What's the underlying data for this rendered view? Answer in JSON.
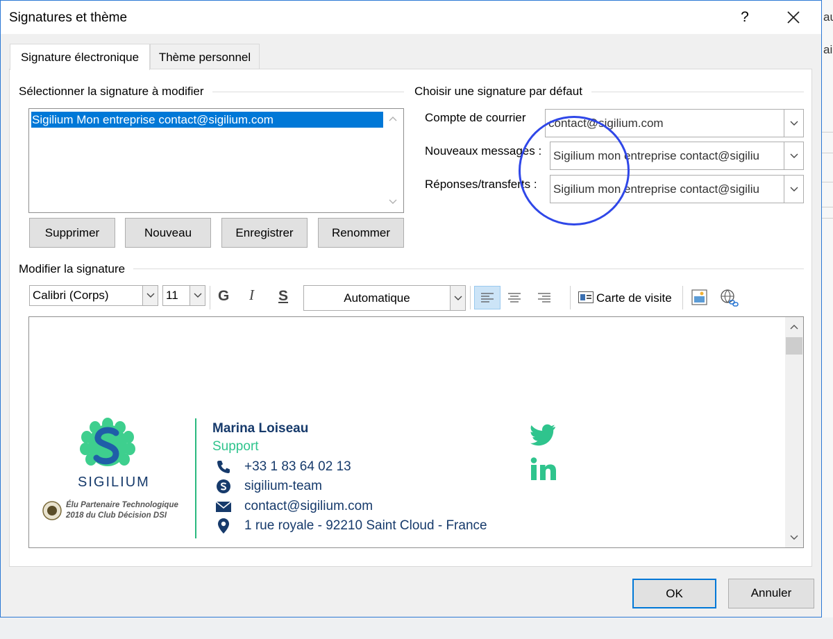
{
  "window": {
    "title": "Signatures et thème",
    "help_label": "?",
    "close_icon": "close-icon"
  },
  "background_window": {
    "fragment_1": "au",
    "fragment_2": "ail"
  },
  "tabs": [
    {
      "label": "Signature électronique",
      "active": true
    },
    {
      "label": "Thème personnel",
      "active": false
    }
  ],
  "select_section": {
    "title": "Sélectionner la signature à modifier",
    "signatures": [
      "Sigilium Mon entreprise  contact@sigilium.com"
    ],
    "buttons": {
      "delete": "Supprimer",
      "new": "Nouveau",
      "save": "Enregistrer",
      "rename": "Renommer"
    }
  },
  "default_section": {
    "title": "Choisir une signature par défaut",
    "account_label": "Compte de courrier",
    "account_value": "contact@sigilium.com",
    "new_messages_label": "Nouveaux messages :",
    "new_messages_value": "Sigilium mon entreprise contact@sigiliu",
    "replies_label": "Réponses/transferts :",
    "replies_value": "Sigilium mon entreprise contact@sigiliu"
  },
  "editor_section": {
    "title": "Modifier la signature",
    "font_family": "Calibri (Corps)",
    "font_size": "11",
    "bold_glyph": "G",
    "italic_glyph": "I",
    "underline_glyph": "S",
    "color_value": "Automatique",
    "business_card_label": "Carte de visite"
  },
  "signature": {
    "brand": "SIGILIUM",
    "award_line1": "Élu Partenaire Technologique",
    "award_line2": "2018 du Club Décision DSI",
    "name": "Marina Loiseau",
    "role": "Support",
    "phone": "+33 1 83 64 02 13",
    "skype": "sigilium-team",
    "email": "contact@sigilium.com",
    "address": "1 rue royale - 92210 Saint Cloud - France",
    "colors": {
      "navy": "#163a6b",
      "green": "#2fc48d"
    }
  },
  "footer": {
    "ok": "OK",
    "cancel": "Annuler"
  }
}
